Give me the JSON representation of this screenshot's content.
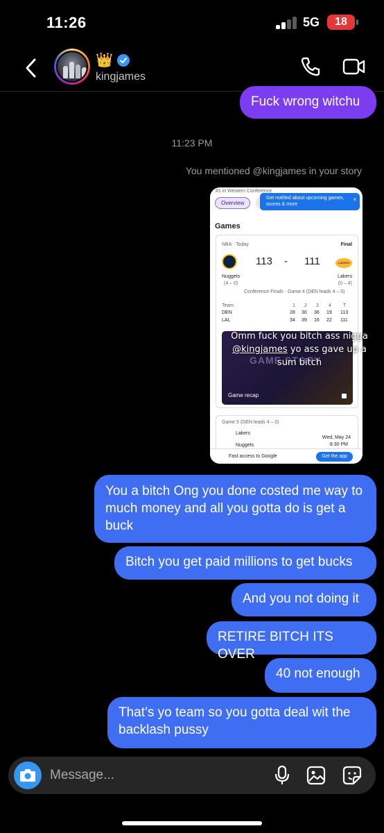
{
  "status_bar": {
    "time": "11:26",
    "network": "5G",
    "battery": "18"
  },
  "header": {
    "username": "kingjames",
    "crown": "👑"
  },
  "messages": {
    "first": "Fuck wrong witchu",
    "timestamp": "11:23 PM",
    "mention_note": "You mentioned @kingjames in your story",
    "m1": "You a bitch Ong you done costed me way to much money and all you gotta do is get a buck",
    "m2": "Bitch you get paid millions to get bucks",
    "m3": "And you not doing it",
    "m4": "RETIRE BITCH ITS OVER",
    "m5": "40 not enough",
    "m6": "That’s yo team so you gotta deal wit the backlash pussy"
  },
  "story": {
    "top_text": "#1 in Western Conference",
    "overview_chip": "Overview",
    "tooltip": "Get notified about upcoming games, scores & more",
    "tooltip_close": "×",
    "games_title": "Games",
    "league_date": "NBA · Today",
    "final": "Final",
    "home_score": "113",
    "away_score": "111",
    "score_dash": "-",
    "home_team": "Nuggets",
    "home_record": "(4 – 0)",
    "away_team": "Lakers",
    "away_record": "(0 – 4)",
    "series_note": "Conference Finals · Game 4 (DEN leads 4 – 0)",
    "box_header": {
      "team": "Team",
      "q1": "1",
      "q2": "2",
      "q3": "3",
      "q4": "4",
      "t": "T"
    },
    "box_rows": [
      {
        "team": "DEN",
        "q1": "28",
        "q2": "30",
        "q3": "36",
        "q4": "19",
        "t": "113"
      },
      {
        "team": "LAL",
        "q1": "34",
        "q2": "39",
        "q3": "16",
        "q4": "22",
        "t": "111"
      }
    ],
    "recap_bg_text": "GAME STORY",
    "recap_label": "Game recap",
    "lakers_logo_text": "LAKERS",
    "overlay_line1": "Omm fuck you bitch ass nigga",
    "overlay_mention": "@kingjames",
    "overlay_rest": " yo ass gave up a sum bitch",
    "game5": "Game 5 (DEN leads 4 – 0)",
    "game5_team1": "Lakers",
    "game5_team2": "Nuggets",
    "game5_date": "Wed, May 24",
    "game5_time": "8:30 PM",
    "banner_text": "Fast access to Google",
    "banner_button": "Get the app"
  },
  "composer": {
    "placeholder": "Message..."
  },
  "colors": {
    "sent_blue": "#3f6ef2",
    "sent_purple": "#7c3cf0",
    "camera_blue": "#3797f0",
    "background": "#000000"
  }
}
